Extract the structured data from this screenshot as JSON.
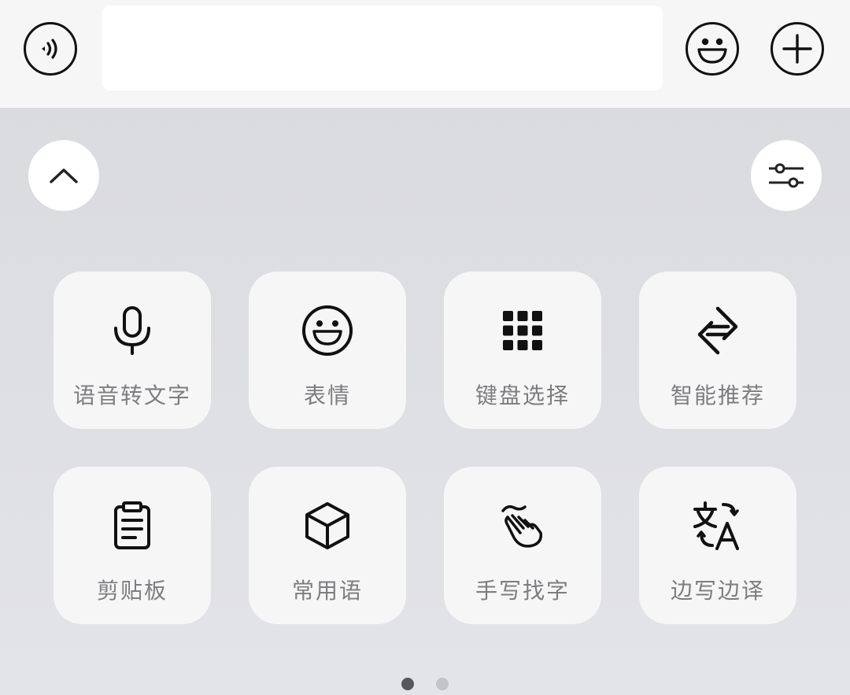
{
  "input_bar": {
    "text_value": "",
    "voice_icon": "voice-wave-icon",
    "emoji_icon": "smiley-icon",
    "more_icon": "plus-icon"
  },
  "panel": {
    "collapse_icon": "chevron-up-icon",
    "settings_icon": "sliders-icon",
    "tiles": [
      {
        "label": "语音转文字",
        "icon": "microphone-icon"
      },
      {
        "label": "表情",
        "icon": "smiley-icon"
      },
      {
        "label": "键盘选择",
        "icon": "keypad-grid-icon"
      },
      {
        "label": "智能推荐",
        "icon": "smart-recommend-icon"
      },
      {
        "label": "剪贴板",
        "icon": "clipboard-icon"
      },
      {
        "label": "常用语",
        "icon": "cube-icon"
      },
      {
        "label": "手写找字",
        "icon": "handwriting-hand-icon"
      },
      {
        "label": "边写边译",
        "icon": "translate-icon"
      }
    ],
    "page_indicator": {
      "pages": 2,
      "current": 1
    }
  },
  "colors": {
    "input_bar_bg": "#f6f6f6",
    "panel_bg": "#e0e1e4",
    "tile_bg": "#f6f6f7",
    "label_text": "#7d7d80",
    "icon": "#111111"
  }
}
